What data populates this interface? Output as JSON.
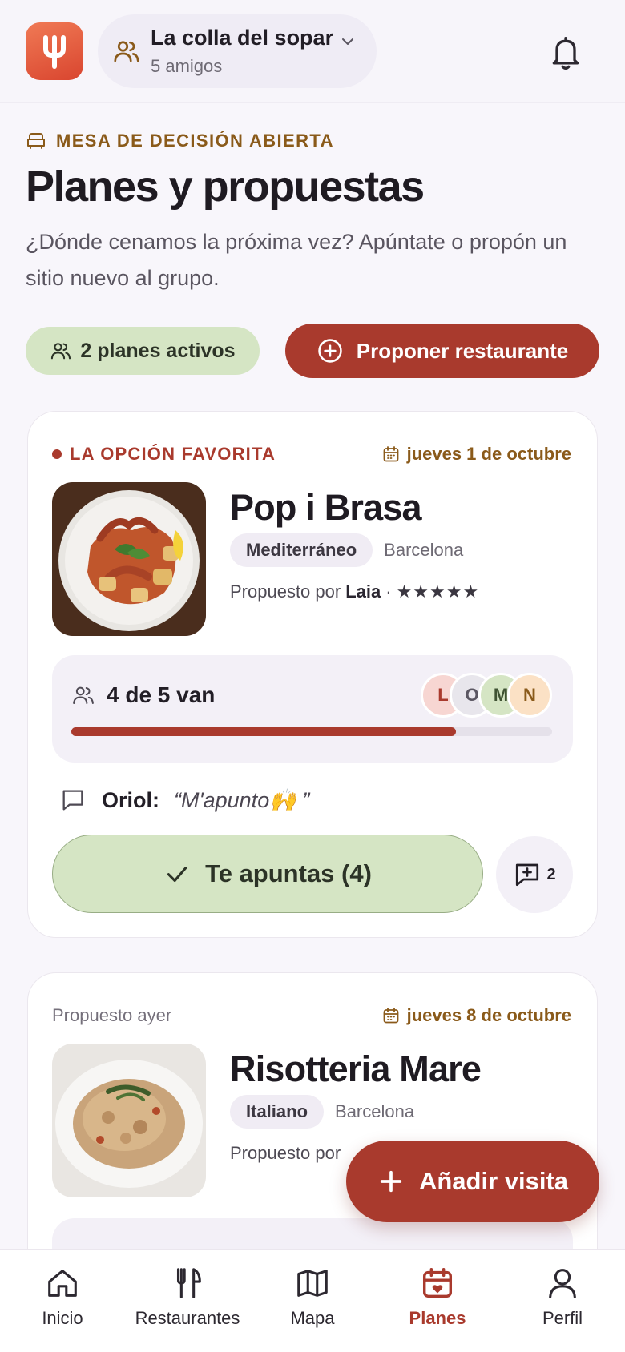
{
  "header": {
    "group_name": "La colla del sopar",
    "group_sub": "5 amigos"
  },
  "intro": {
    "eyebrow": "MESA DE DECISIÓN ABIERTA",
    "title": "Planes y propuestas",
    "subtitle": "¿Dónde cenamos la próxima vez? Apúntate o propón un sitio nuevo al grupo."
  },
  "actions": {
    "active_plans": "2 planes activos",
    "propose_label": "Proponer restaurante"
  },
  "plans": [
    {
      "badge": "LA OPCIÓN FAVORITA",
      "date": "jueves 1 de octubre",
      "name": "Pop i Brasa",
      "cuisine": "Mediterráneo",
      "city": "Barcelona",
      "proposed_prefix": "Propuesto por",
      "proposer": "Laia",
      "separator": "·",
      "stars": "★★★★★",
      "rating": 5,
      "attendance_text": "4 de 5 van",
      "attendance_fraction": 0.8,
      "avatars": [
        {
          "initial": "L",
          "bg": "#f7d6d2",
          "fg": "#a93a2d"
        },
        {
          "initial": "O",
          "bg": "#e8e6ec",
          "fg": "#5b5762"
        },
        {
          "initial": "M",
          "bg": "#d5e5c4",
          "fg": "#3f5233"
        },
        {
          "initial": "N",
          "bg": "#fbe1c5",
          "fg": "#8a5a1a"
        }
      ],
      "comment_author": "Oriol:",
      "comment_text": "“M'apunto🙌 ”",
      "join_label": "Te apuntas (4)",
      "chat_count": "2"
    },
    {
      "proposed_when": "Propuesto ayer",
      "date": "jueves 8 de octubre",
      "name": "Risotteria Mare",
      "cuisine": "Italiano",
      "city": "Barcelona",
      "proposed_prefix": "Propuesto por"
    }
  ],
  "fab": {
    "label": "Añadir visita"
  },
  "nav": [
    {
      "label": "Inicio",
      "icon": "home-icon"
    },
    {
      "label": "Restaurantes",
      "icon": "fork-knife-icon"
    },
    {
      "label": "Mapa",
      "icon": "map-icon"
    },
    {
      "label": "Planes",
      "icon": "calendar-heart-icon",
      "active": true
    },
    {
      "label": "Perfil",
      "icon": "user-icon"
    }
  ],
  "colors": {
    "brand": "#a93a2d",
    "accent_gold": "#8a5a1a",
    "success_soft": "#d5e5c4",
    "surface": "#f8f6fb"
  }
}
